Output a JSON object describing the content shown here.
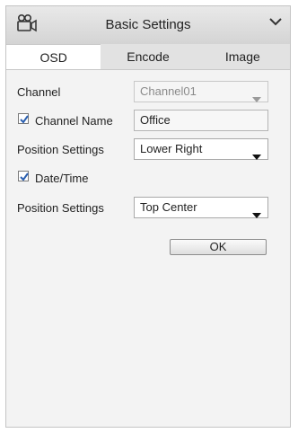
{
  "panel": {
    "title": "Basic Settings",
    "title_icon": "camera-icon",
    "collapse_icon": "chevron-down-icon"
  },
  "tabs": [
    {
      "label": "OSD",
      "active": true
    },
    {
      "label": "Encode",
      "active": false
    },
    {
      "label": "Image",
      "active": false
    }
  ],
  "osd": {
    "channel": {
      "label": "Channel",
      "value": "Channel01"
    },
    "channel_name": {
      "label": "Channel Name",
      "checked": true,
      "value": "Office"
    },
    "channel_name_position": {
      "label": "Position Settings",
      "value": "Lower Right"
    },
    "date_time": {
      "label": "Date/Time",
      "checked": true
    },
    "date_time_position": {
      "label": "Position Settings",
      "value": "Top Center"
    },
    "ok_label": "OK"
  }
}
